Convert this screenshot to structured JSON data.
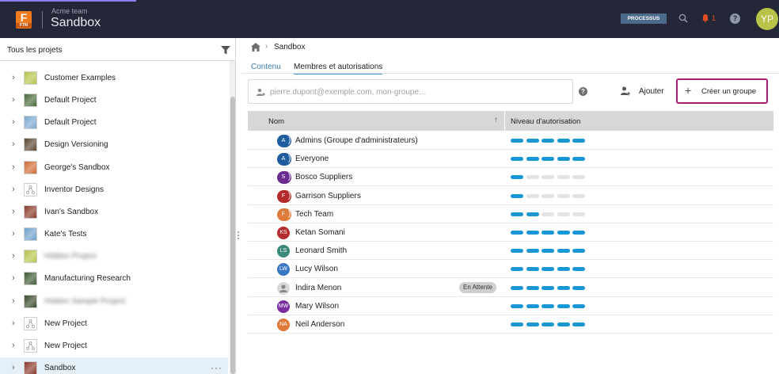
{
  "header": {
    "logo_letter": "F",
    "logo_sub": "FTM",
    "team_name": "Acme team",
    "project_name": "Sandbox",
    "processus_label": "PROCESSUS",
    "notification_count": "1",
    "help_label": "?",
    "avatar_initials": "YP"
  },
  "sidebar": {
    "title": "Tous les projets",
    "projects": [
      {
        "name": "Customer Examples",
        "thumb": "#b7c44b",
        "blurred": false,
        "active": false
      },
      {
        "name": "Default Project",
        "thumb": "#4a6a3a",
        "blurred": false,
        "active": false
      },
      {
        "name": "Default Project",
        "thumb": "#7aa8d0",
        "blurred": false,
        "active": false
      },
      {
        "name": "Design Versioning",
        "thumb": "#5a4632",
        "blurred": false,
        "active": false
      },
      {
        "name": "George's Sandbox",
        "thumb": "#d06a35",
        "blurred": false,
        "active": false
      },
      {
        "name": "Inventor Designs",
        "thumb": "#ffffff",
        "blurred": false,
        "active": false
      },
      {
        "name": "Ivan's Sandbox",
        "thumb": "#8a3a2a",
        "blurred": false,
        "active": false
      },
      {
        "name": "Kate's Tests",
        "thumb": "#6ea0cc",
        "blurred": false,
        "active": false
      },
      {
        "name": "Hidden Project",
        "thumb": "#b7c44b",
        "blurred": true,
        "active": false
      },
      {
        "name": "Manufacturing Research",
        "thumb": "#3e5a33",
        "blurred": false,
        "active": false
      },
      {
        "name": "Hidden Sample Project",
        "thumb": "#3b4a2c",
        "blurred": true,
        "active": false
      },
      {
        "name": "New Project",
        "thumb": "#ffffff",
        "blurred": false,
        "active": false
      },
      {
        "name": "New Project",
        "thumb": "#ffffff",
        "blurred": false,
        "active": false
      },
      {
        "name": "Sandbox",
        "thumb": "#8a3a2a",
        "blurred": false,
        "active": true
      }
    ],
    "more_label": "···"
  },
  "breadcrumb": {
    "current": "Sandbox"
  },
  "tabs": [
    {
      "label": "Contenu"
    },
    {
      "label": "Membres et autorisations"
    }
  ],
  "search": {
    "placeholder": "pierre.dupont@exemple.com, mon-groupe...",
    "value": ""
  },
  "actions": {
    "add_label": "Ajouter",
    "create_group_label": "Créer un groupe",
    "help_label": "?"
  },
  "table": {
    "col_name": "Nom",
    "col_level": "Niveau d'autorisation",
    "sort_arrow": "↑",
    "members": [
      {
        "initials": "A",
        "name": "Admins (Groupe d'administrateurs)",
        "color": "#1f5d9e",
        "group": true,
        "level": 5,
        "badge": ""
      },
      {
        "initials": "A",
        "name": "Everyone",
        "color": "#1f5d9e",
        "group": true,
        "level": 5,
        "badge": ""
      },
      {
        "initials": "S",
        "name": "Bosco Suppliers",
        "color": "#6b2c91",
        "group": true,
        "level": 1,
        "badge": ""
      },
      {
        "initials": "F",
        "name": "Garrison Suppliers",
        "color": "#b52b2b",
        "group": true,
        "level": 1,
        "badge": ""
      },
      {
        "initials": "F",
        "name": "Tech Team",
        "color": "#e07a3a",
        "group": true,
        "level": 2,
        "badge": ""
      },
      {
        "initials": "KS",
        "name": "Ketan Somani",
        "color": "#b52b2b",
        "group": false,
        "level": 5,
        "badge": ""
      },
      {
        "initials": "LS",
        "name": "Leonard Smith",
        "color": "#3a8a7a",
        "group": false,
        "level": 5,
        "badge": ""
      },
      {
        "initials": "LW",
        "name": "Lucy Wilson",
        "color": "#3a78c4",
        "group": false,
        "level": 5,
        "badge": ""
      },
      {
        "initials": "",
        "name": "Indira Menon",
        "color": "#d8d8d8",
        "group": false,
        "level": 5,
        "badge": "En Attente"
      },
      {
        "initials": "MW",
        "name": "Mary Wilson",
        "color": "#7b2ea0",
        "group": false,
        "level": 5,
        "badge": ""
      },
      {
        "initials": "NA",
        "name": "Neil Anderson",
        "color": "#e07a3a",
        "group": false,
        "level": 5,
        "badge": ""
      }
    ],
    "level_max": 5
  },
  "colors": {
    "accent": "#1996d4",
    "highlight_border": "#a01f74",
    "topbar": "#232737"
  }
}
